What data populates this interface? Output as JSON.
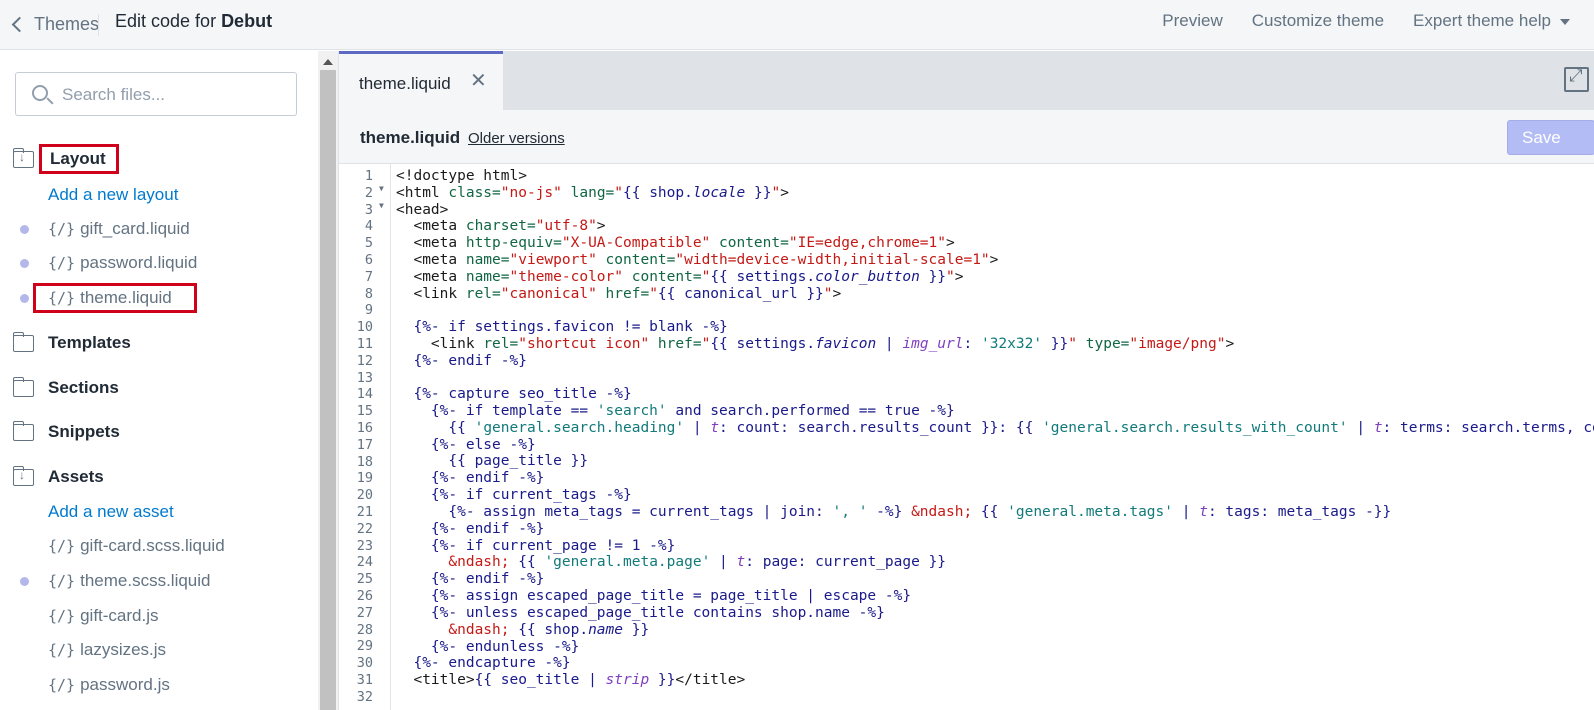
{
  "header": {
    "back_label": "Themes",
    "title_prefix": "Edit code for ",
    "title_theme": "Debut",
    "links": {
      "preview": "Preview",
      "customize": "Customize theme",
      "help": "Expert theme help"
    }
  },
  "sidebar": {
    "search_placeholder": "Search files...",
    "folders": {
      "layout": "Layout",
      "templates": "Templates",
      "sections": "Sections",
      "snippets": "Snippets",
      "assets": "Assets"
    },
    "layout_add": "Add a new layout",
    "layout_files": [
      "gift_card.liquid",
      "password.liquid",
      "theme.liquid"
    ],
    "assets_add": "Add a new asset",
    "asset_files": [
      "gift-card.scss.liquid",
      "theme.scss.liquid",
      "gift-card.js",
      "lazysizes.js",
      "password.js"
    ],
    "file_icon": "{/}"
  },
  "editor": {
    "tab_label": "theme.liquid",
    "file_name": "theme.liquid",
    "older_versions": "Older versions",
    "save_label": "Save",
    "line_numbers": [
      "1",
      "2",
      "3",
      "4",
      "5",
      "6",
      "7",
      "8",
      "9",
      "10",
      "11",
      "12",
      "13",
      "14",
      "15",
      "16",
      "17",
      "18",
      "19",
      "20",
      "21",
      "22",
      "23",
      "24",
      "25",
      "26",
      "27",
      "28",
      "29",
      "30",
      "31",
      "32"
    ]
  },
  "colors": {
    "accent": "#5c6ac4",
    "link": "#007ace",
    "highlight": "#d0021b",
    "save_disabled": "#b3bcf5"
  },
  "icons": {
    "back": "chevron-left-icon",
    "search": "search-icon",
    "folder": "folder-icon",
    "close": "close-icon",
    "expand": "expand-icon"
  }
}
